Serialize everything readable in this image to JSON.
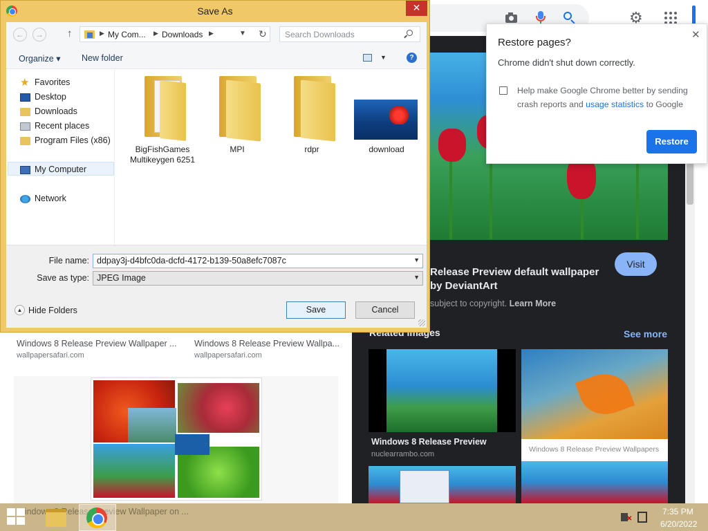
{
  "dialog": {
    "title": "Save As",
    "close_label": "✕",
    "address": {
      "segment1": "My Com...",
      "segment2": "Downloads"
    },
    "search_placeholder": "Search Downloads",
    "toolbar": {
      "organize": "Organize ▾",
      "new_folder": "New folder"
    },
    "nav_pane": {
      "favorites": "Favorites",
      "desktop": "Desktop",
      "downloads": "Downloads",
      "recent_places": "Recent places",
      "program_files": "Program Files (x86)",
      "my_computer": "My Computer",
      "network": "Network"
    },
    "files": [
      {
        "name": "BigFishGames Multikeygen 6251",
        "icon": "folder-with-papers-icon"
      },
      {
        "name": "MPI",
        "icon": "folder-icon"
      },
      {
        "name": "rdpr",
        "icon": "folder-icon"
      },
      {
        "name": "download",
        "icon": "image-thumbnail-icon"
      }
    ],
    "file_name_label": "File name:",
    "file_name_value": "ddpay3j-d4bfc0da-dcfd-4172-b139-50a8efc7087c",
    "save_type_label": "Save as type:",
    "save_type_value": "JPEG Image",
    "hide_folders": "Hide Folders",
    "save_button": "Save",
    "cancel_button": "Cancel"
  },
  "restore_popup": {
    "title": "Restore pages?",
    "message": "Chrome didn't shut down correctly.",
    "help_text_before": "Help make Google Chrome better by sending crash reports and ",
    "help_link": "usage statistics",
    "help_text_after": " to Google",
    "restore_button": "Restore",
    "close_label": "✕"
  },
  "image_panel": {
    "title": "Release Preview default wallpaper by DeviantArt",
    "visit_button": "Visit",
    "copyright_text": "subject to copyright.",
    "learn_more": "Learn More",
    "related_heading": "Related images",
    "see_more": "See more",
    "related": [
      {
        "title": "Windows 8 Release Preview",
        "source": "nuclearrambo.com"
      },
      {
        "caption": "Windows 8 Release Preview Wallpapers"
      }
    ]
  },
  "left_results": [
    {
      "title": "Windows 8 Release Preview Wallpaper ...",
      "source": "wallpapersafari.com"
    },
    {
      "title": "Windows 8 Release Preview Wallpa...",
      "source": "wallpapersafari.com"
    }
  ],
  "taskbar": {
    "ghost_text": "Windows 8 Release Preview Wallpaper on ...",
    "time": "7:35 PM",
    "date": "6/20/2022"
  },
  "colors": {
    "dialog_frame": "#f0c868",
    "chrome_blue": "#1a73e8",
    "dark_panel": "#202124",
    "close_red": "#c7322a"
  }
}
